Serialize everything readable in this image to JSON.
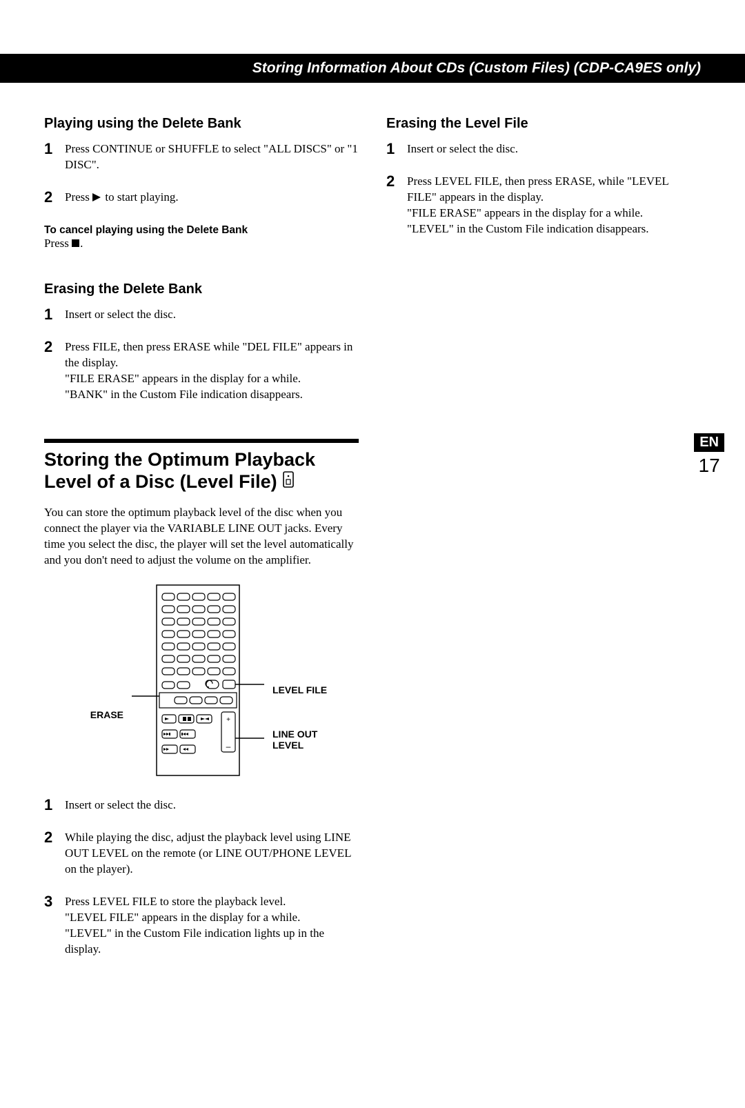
{
  "header": "Storing Information About CDs (Custom Files) (CDP-CA9ES only)",
  "left": {
    "h1": "Playing using the Delete Bank",
    "s1": "Press CONTINUE or SHUFFLE to select \"ALL DISCS\" or \"1 DISC\".",
    "s2a": "Press ",
    "s2b": " to start playing.",
    "cancel_h": "To cancel playing using the Delete Bank",
    "cancel_b1": "Press ",
    "cancel_b2": ".",
    "h2": "Erasing the Delete Bank",
    "e1": "Insert or select the disc.",
    "e2": "Press FILE, then press ERASE while \"DEL FILE\" appears in the display.\n\"FILE ERASE\" appears in the display for a while.\n\"BANK\" in the Custom File indication disappears.",
    "sec_title": "Storing the Optimum Playback Level of a Disc (Level File)",
    "intro": "You can store the optimum playback level of the disc when you connect the player via the VARIABLE LINE OUT jacks. Every time you select the disc, the player will set the level automatically and you don't need to adjust the volume on the amplifier.",
    "lbl_erase": "ERASE",
    "lbl_levelfile": "LEVEL FILE",
    "lbl_lineout": "LINE OUT LEVEL",
    "p1": "Insert or select the disc.",
    "p2": "While playing the disc, adjust the playback level using LINE OUT LEVEL on the remote (or LINE OUT/PHONE LEVEL on the player).",
    "p3": "Press LEVEL FILE to store the playback level.\n\"LEVEL FILE\" appears in the display for a while.\n\"LEVEL\" in the Custom File indication lights up in the display."
  },
  "right": {
    "h1": "Erasing the Level File",
    "s1": "Insert or select the disc.",
    "s2": "Press LEVEL FILE, then press ERASE, while \"LEVEL FILE\" appears in the display.\n\"FILE ERASE\" appears in the display for a while.\n\"LEVEL\" in the Custom File indication disappears."
  },
  "side": {
    "lang": "EN",
    "page": "17"
  }
}
